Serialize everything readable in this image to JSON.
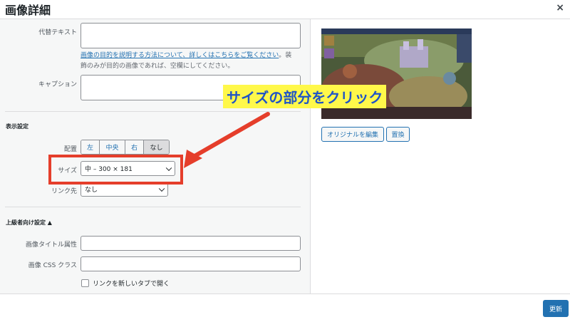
{
  "header": {
    "title": "画像詳細",
    "close": "×"
  },
  "form": {
    "alt_label": "代替テキスト",
    "alt_value": "",
    "help_link": "画像の目的を説明する方法について、詳しくはこちらをご覧ください",
    "help_rest_1": "。装",
    "help_rest_2": "飾のみが目的の画像であれば、空欄にしてください。",
    "caption_label": "キャプション",
    "caption_value": ""
  },
  "display": {
    "heading": "表示設定",
    "align_label": "配置",
    "align_options": [
      "左",
      "中央",
      "右",
      "なし"
    ],
    "size_label": "サイズ",
    "size_value": "中 – 300 × 181",
    "link_label": "リンク先",
    "link_value": "なし"
  },
  "advanced": {
    "heading": "上級者向け設定 ▲",
    "title_attr_label": "画像タイトル属性",
    "title_attr_value": "",
    "css_class_label": "画像 CSS クラス",
    "css_class_value": "",
    "new_tab_label": "リンクを新しいタブで開く"
  },
  "preview": {
    "edit_original": "オリジナルを編集",
    "replace": "置換"
  },
  "annotation": {
    "text": "サイズの部分をクリック"
  },
  "footer": {
    "update": "更新"
  },
  "colors": {
    "accent": "#2271b1",
    "highlight": "#e53e2b",
    "annotation_bg": "#fff84a",
    "annotation_text": "#1f54c7"
  }
}
